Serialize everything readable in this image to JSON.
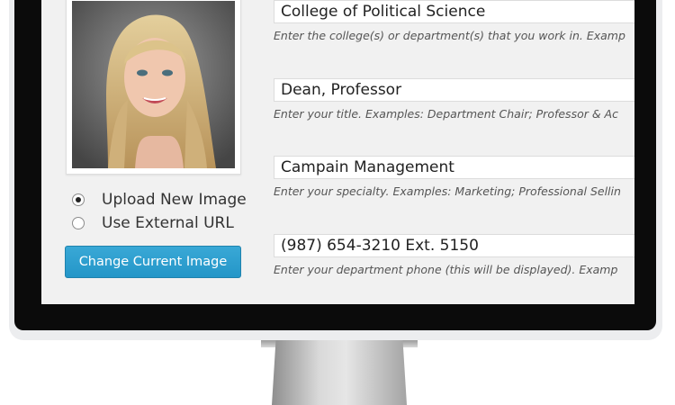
{
  "profile": {
    "image_options": [
      {
        "label": "Upload New Image",
        "selected": true
      },
      {
        "label": "Use External URL",
        "selected": false
      }
    ],
    "change_button_label": "Change Current Image"
  },
  "fields": [
    {
      "value": "College of Political Science",
      "hint": "Enter the college(s) or department(s) that you work in. Examp"
    },
    {
      "value": "Dean, Professor",
      "hint": "Enter your title. Examples: Department Chair; Professor & Ac"
    },
    {
      "value": "Campain Management",
      "hint": "Enter your specialty. Examples: Marketing; Professional Sellin"
    },
    {
      "value": "(987) 654-3210 Ext. 5150",
      "hint": "Enter your department phone (this will be displayed). Examp"
    }
  ],
  "colors": {
    "button": "#2b9fd0",
    "bezel": "#0b0b0b",
    "screen_bg": "#f1f1f1"
  }
}
